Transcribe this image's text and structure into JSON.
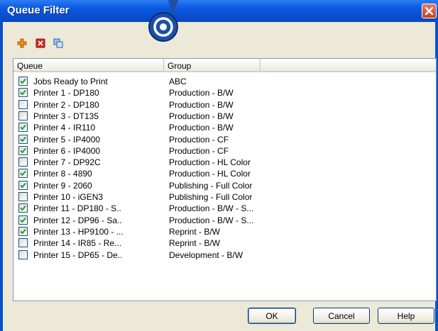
{
  "window": {
    "title": "Queue Filter"
  },
  "toolbar": {
    "icons": [
      "add-icon",
      "delete-icon",
      "copy-icon"
    ]
  },
  "columns": {
    "queue": "Queue",
    "group": "Group"
  },
  "rows": [
    {
      "queue": "Jobs Ready to Print",
      "group": "ABC",
      "checked": true
    },
    {
      "queue": "Printer  1 - DP180",
      "group": "Production - B/W",
      "checked": true
    },
    {
      "queue": "Printer  2 - DP180",
      "group": "Production - B/W",
      "checked": false
    },
    {
      "queue": "Printer  3 - DT135",
      "group": "Production - B/W",
      "checked": false
    },
    {
      "queue": "Printer  4 - IR110",
      "group": "Production - B/W",
      "checked": true
    },
    {
      "queue": "Printer  5 - IP4000",
      "group": "Production - CF",
      "checked": true
    },
    {
      "queue": "Printer  6 - IP4000",
      "group": "Production - CF",
      "checked": true
    },
    {
      "queue": "Printer  7 - DP92C",
      "group": "Production - HL Color",
      "checked": false
    },
    {
      "queue": "Printer  8 - 4890",
      "group": "Production - HL Color",
      "checked": true
    },
    {
      "queue": "Printer  9 - 2060",
      "group": "Publishing - Full Color",
      "checked": true
    },
    {
      "queue": "Printer 10 - iGEN3",
      "group": "Publishing - Full Color",
      "checked": false
    },
    {
      "queue": "Printer 11 - DP180 - S..",
      "group": "Production - B/W - S...",
      "checked": true
    },
    {
      "queue": "Printer 12 - DP96 - Sa..",
      "group": "Production - B/W - S...",
      "checked": true
    },
    {
      "queue": "Printer 13 - HP9100 - ...",
      "group": "Reprint - B/W",
      "checked": true
    },
    {
      "queue": "Printer 14 - IR85 - Re...",
      "group": "Reprint - B/W",
      "checked": false
    },
    {
      "queue": "Printer 15 - DP65 - De..",
      "group": "Development - B/W",
      "checked": false
    }
  ],
  "buttons": {
    "ok": "OK",
    "cancel": "Cancel",
    "help": "Help"
  },
  "colors": {
    "titlebar": "#0b5be3",
    "client": "#ece9d8",
    "check": "#21a121",
    "close": "#d0502c"
  }
}
